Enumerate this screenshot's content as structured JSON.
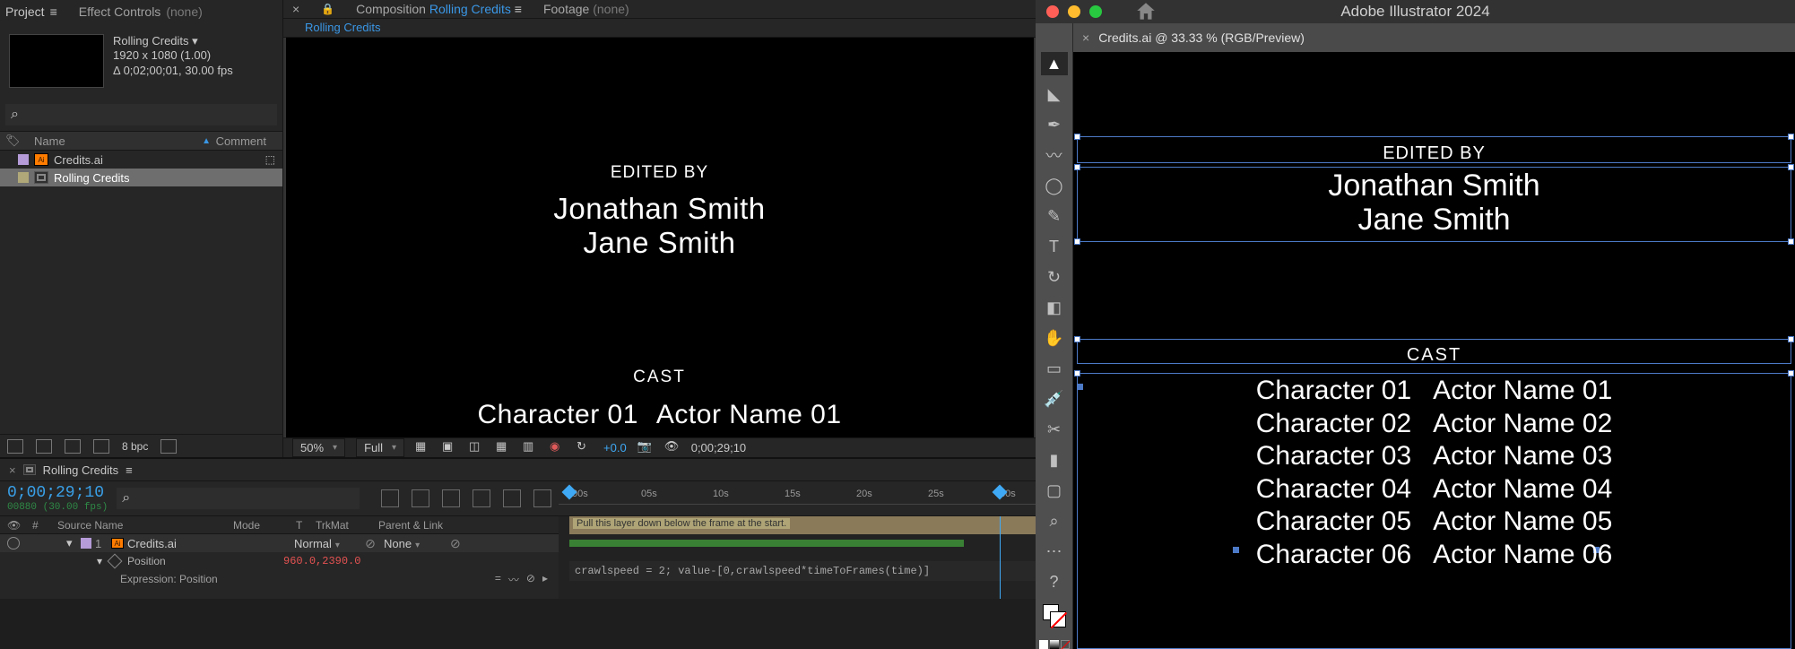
{
  "ae": {
    "tabs": {
      "project": "Project",
      "effect_controls": "Effect Controls",
      "effect_controls_arg": "(none)",
      "composition": "Composition",
      "comp_name": "Rolling Credits",
      "footage": "Footage",
      "footage_arg": "(none)"
    },
    "comp_sub_tab": "Rolling Credits",
    "thumb": {
      "title": "Rolling Credits ▾",
      "dims": "1920 x 1080 (1.00)",
      "dur": "Δ 0;02;00;01, 30.00 fps"
    },
    "project_headers": {
      "name": "Name",
      "comment": "Comment"
    },
    "project_items": [
      {
        "type": "ai",
        "name": "Credits.ai"
      },
      {
        "type": "comp",
        "name": "Rolling Credits",
        "selected": true
      }
    ],
    "project_footer": {
      "bpc": "8 bpc"
    },
    "viewer": {
      "edited_by": "EDITED BY",
      "name1": "Jonathan Smith",
      "name2": "Jane Smith",
      "cast": "CAST",
      "char": "Character 01",
      "actor": "Actor Name 01"
    },
    "viewer_toolbar": {
      "zoom": "50%",
      "res": "Full",
      "exposure": "+0.0",
      "tc": "0;00;29;10"
    },
    "timeline": {
      "tab": "Rolling Credits",
      "tc_main": "0;00;29;10",
      "tc_sub": "00880 (30.00 fps)",
      "col": {
        "num": "#",
        "source": "Source Name",
        "mode": "Mode",
        "t": "T",
        "trkmat": "TrkMat",
        "parent": "Parent & Link"
      },
      "layer": {
        "num": "1",
        "name": "Credits.ai",
        "mode": "Normal",
        "trkmat": "None"
      },
      "prop": {
        "label": "Position",
        "value": "960.0,2390.0"
      },
      "expr": {
        "label": "Expression: Position",
        "code": "crawlspeed = 2; value-[0,crawlspeed*timeToFrames(time)]"
      },
      "bar_text": "Pull this layer down below the frame at the start.",
      "ruler": [
        ":00s",
        "05s",
        "10s",
        "15s",
        "20s",
        "25s",
        "30s"
      ]
    }
  },
  "ai": {
    "app_title": "Adobe Illustrator 2024",
    "doc_tab": "Credits.ai @ 33.33 % (RGB/Preview)",
    "content": {
      "edited_by": "EDITED BY",
      "name1": "Jonathan Smith",
      "name2": "Jane Smith",
      "cast": "CAST",
      "chars": [
        "Character 01",
        "Character 02",
        "Character 03",
        "Character 04",
        "Character 05",
        "Character 06"
      ],
      "actors": [
        "Actor Name 01",
        "Actor Name 02",
        "Actor Name 03",
        "Actor Name 04",
        "Actor Name 05",
        "Actor Name 06"
      ]
    },
    "tool_names": [
      "selection",
      "direct-selection",
      "pen",
      "curvature",
      "ellipse",
      "brush",
      "type",
      "rotate",
      "eraser",
      "hand",
      "rectangle",
      "eyedropper",
      "scissors",
      "gradient",
      "artboard",
      "zoom"
    ]
  }
}
